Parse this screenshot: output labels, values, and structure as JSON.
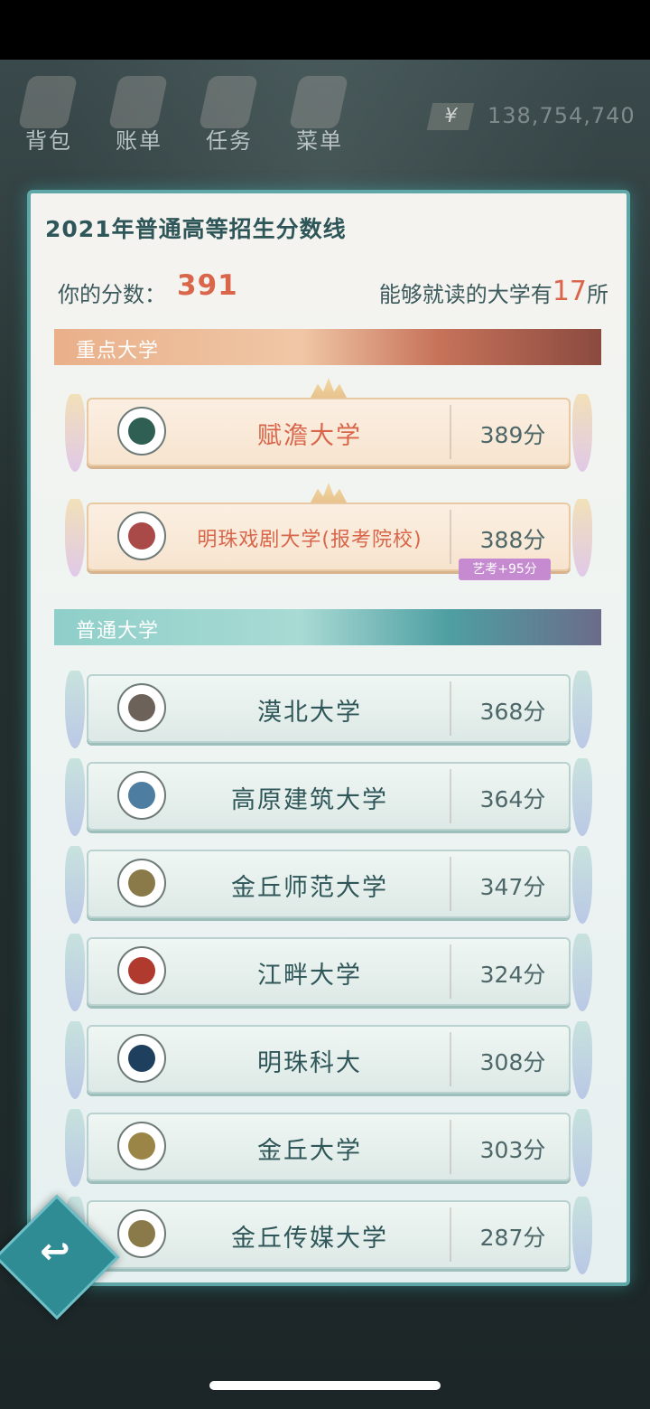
{
  "nav": {
    "items": [
      {
        "label": "背包",
        "icon": "backpack-icon"
      },
      {
        "label": "账单",
        "icon": "bill-icon"
      },
      {
        "label": "任务",
        "icon": "task-icon"
      },
      {
        "label": "菜单",
        "icon": "menu-icon"
      }
    ]
  },
  "money": {
    "symbol": "¥",
    "value": "138,754,740"
  },
  "panel": {
    "title": "2021年普通高等招生分数线",
    "score_label": "你的分数：",
    "score_value": "391",
    "avail_prefix": "能够就读的大学有",
    "avail_count": "17",
    "avail_suffix": "所"
  },
  "sections": {
    "key": "重点大学",
    "normal": "普通大学"
  },
  "key_universities": [
    {
      "name": "赋澹大学",
      "score": "389分",
      "logo_color": "#2f5e52"
    },
    {
      "name": "明珠戏剧大学(报考院校)",
      "score": "388分",
      "badge": "艺考+95分",
      "logo_color": "#a94a48"
    }
  ],
  "normal_universities": [
    {
      "name": "漠北大学",
      "score": "368分",
      "logo_color": "#6d6259"
    },
    {
      "name": "高原建筑大学",
      "score": "364分",
      "logo_color": "#4d7da0"
    },
    {
      "name": "金丘师范大学",
      "score": "347分",
      "logo_color": "#8a7a4a"
    },
    {
      "name": "江畔大学",
      "score": "324分",
      "logo_color": "#b03a2e"
    },
    {
      "name": "明珠科大",
      "score": "308分",
      "logo_color": "#1f3f5e"
    },
    {
      "name": "金丘大学",
      "score": "303分",
      "logo_color": "#9a8446"
    },
    {
      "name": "金丘传媒大学",
      "score": "287分",
      "logo_color": "#8a7a4a"
    }
  ],
  "colors": {
    "accent": "#d9664a",
    "panel_border": "#5fa6a6",
    "back_button": "#2f8b94"
  }
}
